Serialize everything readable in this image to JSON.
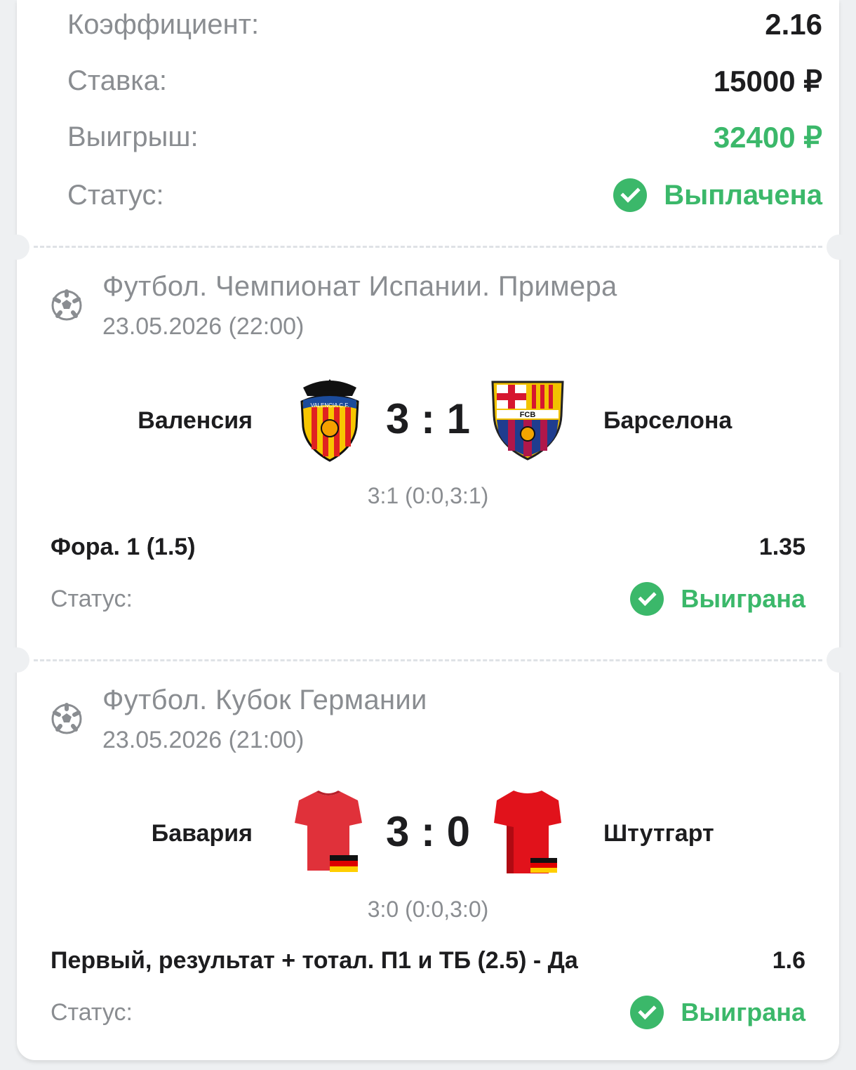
{
  "summary": {
    "coef_label": "Коэффициент:",
    "coef_value": "2.16",
    "stake_label": "Ставка:",
    "stake_value": "15000 ₽",
    "win_label": "Выигрыш:",
    "win_value": "32400 ₽",
    "status_label": "Статус:",
    "status_value": "Выплачена"
  },
  "events": [
    {
      "league": "Футбол. Чемпионат Испании. Примера",
      "date": "23.05.2026 (22:00)",
      "home": "Валенсия",
      "away": "Барселона",
      "score": "3 : 1",
      "score_detail": "3:1 (0:0,3:1)",
      "market": "Фора. 1 (1.5)",
      "odds": "1.35",
      "status_label": "Статус:",
      "status_value": "Выиграна",
      "home_logo_text": "VALENCIA C.F.",
      "away_logo_text": "FCB"
    },
    {
      "league": "Футбол. Кубок Германии",
      "date": "23.05.2026 (21:00)",
      "home": "Бавария",
      "away": "Штутгарт",
      "score": "3 : 0",
      "score_detail": "3:0 (0:0,3:0)",
      "market": "Первый, результат + тотал. П1 и ТБ (2.5) - Да",
      "odds": "1.6",
      "status_label": "Статус:",
      "status_value": "Выиграна"
    }
  ],
  "colors": {
    "accent_green": "#3bb86a",
    "text_dark": "#1d1d1f",
    "text_muted": "#8a8d91"
  }
}
